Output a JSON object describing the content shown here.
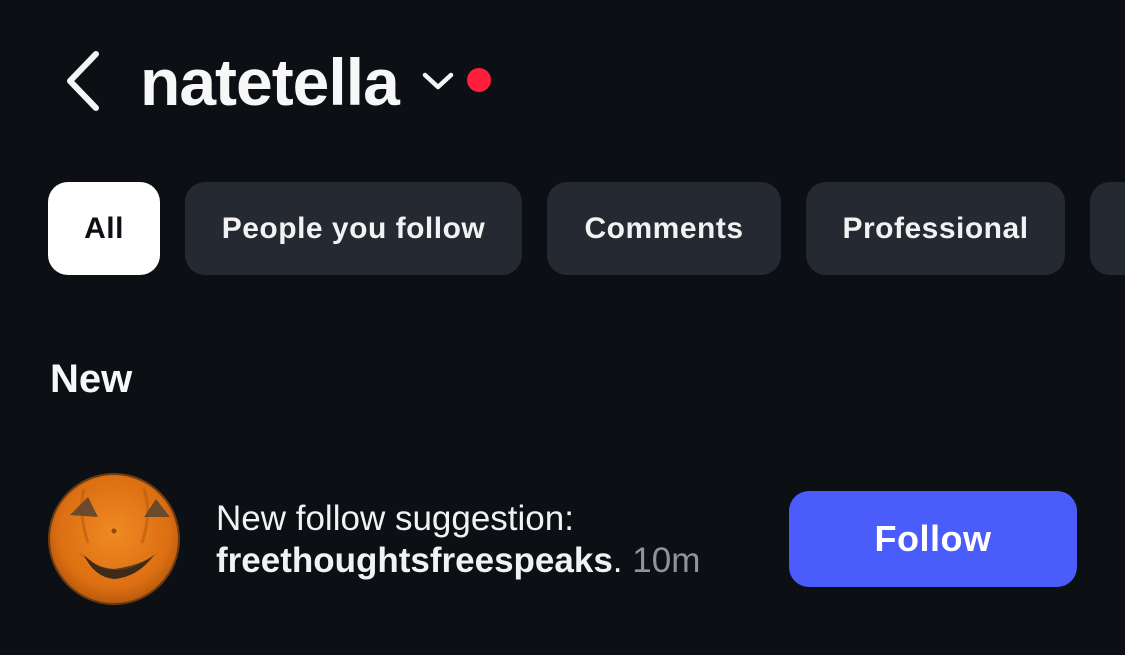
{
  "header": {
    "username": "natetella",
    "back_icon": "chevron-left-icon",
    "switch_icon": "chevron-down-icon",
    "dot_color": "#ff1f3d"
  },
  "filters": [
    {
      "label": "All",
      "active": true
    },
    {
      "label": "People you follow",
      "active": false
    },
    {
      "label": "Comments",
      "active": false
    },
    {
      "label": "Professional",
      "active": false
    },
    {
      "label": "",
      "active": false
    }
  ],
  "section": {
    "title": "New"
  },
  "notification": {
    "avatar_icon": "pumpkin-avatar",
    "text": "New follow suggestion:",
    "handle": "freethoughtsfreespeaks",
    "separator": ".",
    "time": "10m",
    "action_label": "Follow",
    "action_color": "#4a5dfb"
  }
}
